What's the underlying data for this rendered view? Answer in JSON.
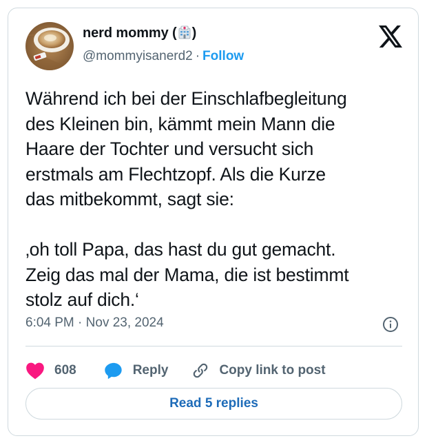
{
  "author": {
    "name_part1": "nerd mommy (",
    "name_part2": ")",
    "name_emoji": "hospital-icon",
    "handle": "@mommyisanerd2",
    "separator": "·",
    "follow_label": "Follow",
    "avatar": "coffee-cup-photo"
  },
  "platform_icon": "x-logo-icon",
  "tweet": {
    "text": "Während ich bei der Einschlafbegleitung\ndes Kleinen bin, kämmt mein Mann die\nHaare der Tochter und versucht sich\nerstmals am Flechtzopf. Als die Kurze\ndas mitbekommt, sagt sie:\n\n‚oh toll Papa, das hast du gut gemacht.\nZeig das mal der Mama, die ist bestimmt\nstolz auf dich.‘"
  },
  "meta": {
    "time": "6:04 PM",
    "separator": "·",
    "date": "Nov 23, 2024"
  },
  "actions": {
    "like_count": "608",
    "reply_label": "Reply",
    "copy_label": "Copy link to post"
  },
  "read_replies_label": "Read 5 replies",
  "colors": {
    "accent": "#1d9bf0",
    "like": "#f91880",
    "secondary_text": "#536471",
    "border": "#cfd9de"
  }
}
